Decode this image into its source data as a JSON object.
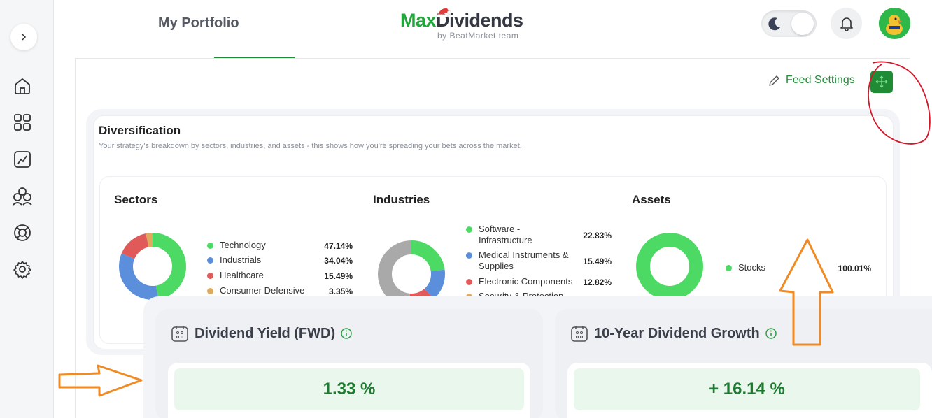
{
  "header": {
    "tab_title": "My Portfolio",
    "logo_max": "Max",
    "logo_dividends": "Dividends",
    "logo_sub": "by BeatMarket team"
  },
  "sidebar": {
    "items": [
      {
        "icon": "home-icon"
      },
      {
        "icon": "grid-icon"
      },
      {
        "icon": "chart-icon"
      },
      {
        "icon": "community-icon"
      },
      {
        "icon": "support-icon"
      },
      {
        "icon": "settings-icon"
      }
    ]
  },
  "toolbar": {
    "feed_settings_label": "Feed Settings"
  },
  "diversification": {
    "title": "Diversification",
    "subtitle": "Your strategy's breakdown by sectors, industries, and assets - this shows how you're spreading your bets across the market.",
    "sectors": {
      "title": "Sectors",
      "items": [
        {
          "label": "Technology",
          "value": "47.14%",
          "pct": 47.14,
          "color": "#4cd964"
        },
        {
          "label": "Industrials",
          "value": "34.04%",
          "pct": 34.04,
          "color": "#5b8fdc"
        },
        {
          "label": "Healthcare",
          "value": "15.49%",
          "pct": 15.49,
          "color": "#e05a5a"
        },
        {
          "label": "Consumer Defensive",
          "value": "3.35%",
          "pct": 3.35,
          "color": "#dfaa5c"
        }
      ]
    },
    "industries": {
      "title": "Industries",
      "items": [
        {
          "label": "Software - Infrastructure",
          "value": "22.83%",
          "pct": 22.83,
          "color": "#4cd964"
        },
        {
          "label": "Medical Instruments & Supplies",
          "value": "15.49%",
          "pct": 15.49,
          "color": "#5b8fdc"
        },
        {
          "label": "Electronic Components",
          "value": "12.82%",
          "pct": 12.82,
          "color": "#e05a5a"
        },
        {
          "label": "Security & Protection",
          "value": "",
          "pct": 0,
          "color": "#dfaa5c"
        }
      ]
    },
    "assets": {
      "title": "Assets",
      "items": [
        {
          "label": "Stocks",
          "value": "100.01%",
          "pct": 100.01,
          "color": "#4cd964"
        }
      ]
    }
  },
  "metrics": [
    {
      "title": "Dividend Yield (FWD)",
      "value": "1.33 %"
    },
    {
      "title": "10-Year Dividend Growth",
      "value": "+ 16.14 %"
    }
  ]
}
